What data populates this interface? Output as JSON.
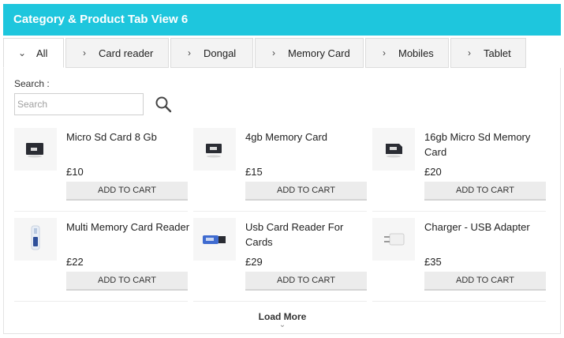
{
  "header": {
    "title": "Category & Product Tab View 6"
  },
  "tabs": [
    {
      "label": "All"
    },
    {
      "label": "Card reader"
    },
    {
      "label": "Dongal"
    },
    {
      "label": "Memory Card"
    },
    {
      "label": "Mobiles"
    },
    {
      "label": "Tablet"
    }
  ],
  "search": {
    "label": "Search :",
    "placeholder": "Search"
  },
  "products": [
    {
      "name": "Micro Sd Card 8 Gb",
      "price": "£10",
      "button": "ADD TO CART",
      "icon": "memory-card-icon"
    },
    {
      "name": "4gb Memory Card",
      "price": "£15",
      "button": "ADD TO CART",
      "icon": "memory-card-icon"
    },
    {
      "name": "16gb Micro Sd Memory Card",
      "price": "£20",
      "button": "ADD TO CART",
      "icon": "memory-card-icon"
    },
    {
      "name": "Multi Memory Card Reader",
      "price": "£22",
      "button": "ADD TO CART",
      "icon": "card-reader-icon"
    },
    {
      "name": "Usb Card Reader For Cards",
      "price": "£29",
      "button": "ADD TO CART",
      "icon": "usb-reader-icon"
    },
    {
      "name": "Charger - USB Adapter",
      "price": "£35",
      "button": "ADD TO CART",
      "icon": "usb-adapter-icon"
    }
  ],
  "load_more": {
    "label": "Load More"
  },
  "colors": {
    "header_bg": "#1ec6dd",
    "button_bg": "#ececec"
  }
}
